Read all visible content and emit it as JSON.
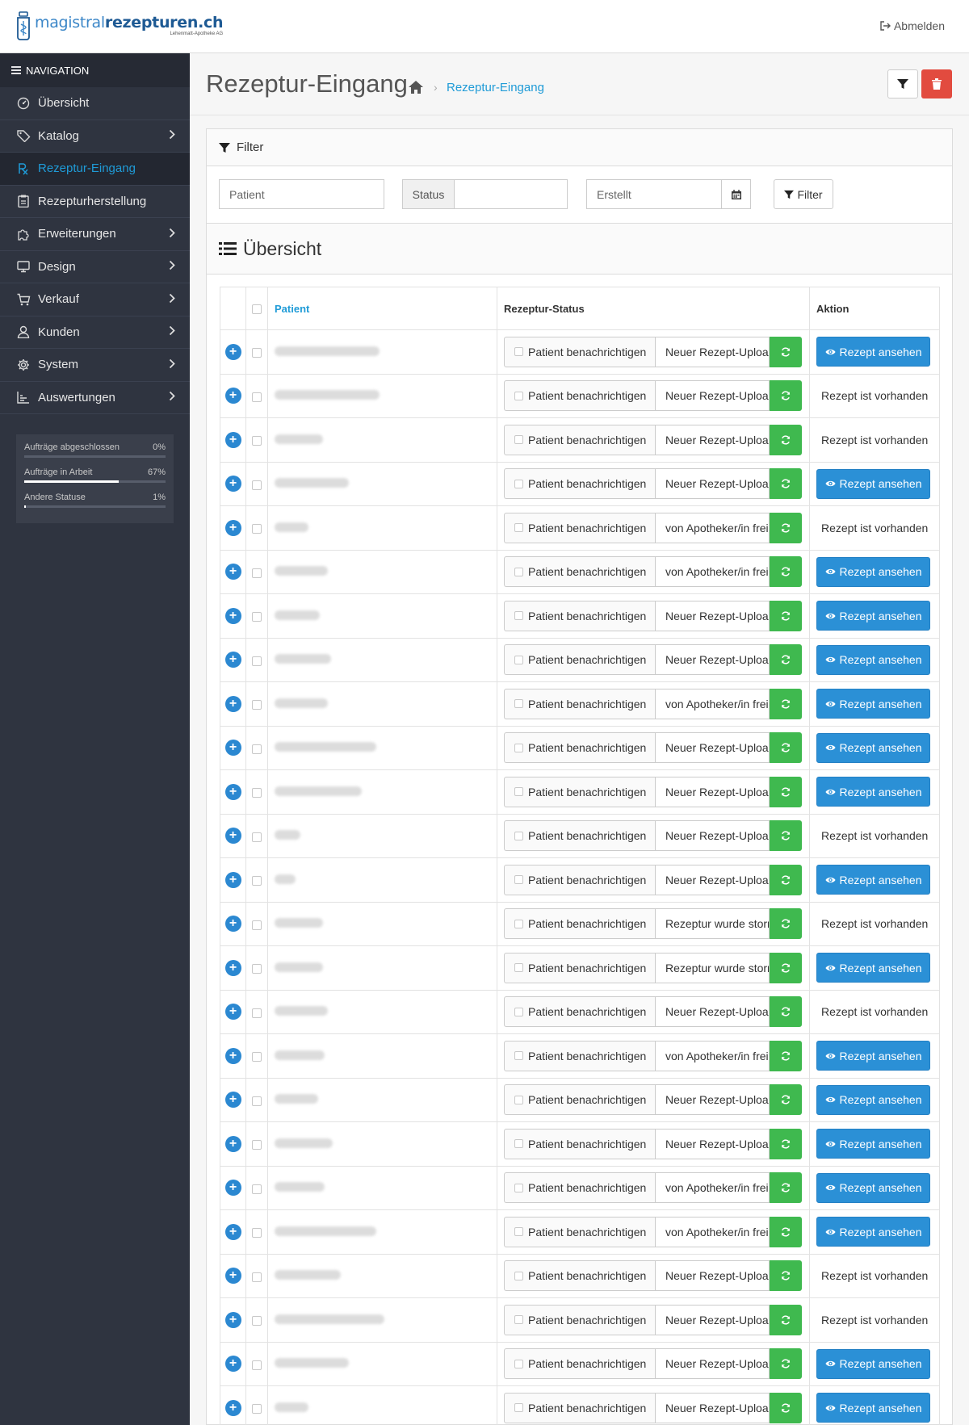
{
  "header": {
    "brand_main": "magistral",
    "brand_bold": "rezepturen.ch",
    "brand_sub": "Lehenmatt-Apotheke AG",
    "logout_label": "Abmelden"
  },
  "sidebar": {
    "heading": "NAVIGATION",
    "items": [
      {
        "label": "Übersicht",
        "icon": "dashboard-icon",
        "chevron": false,
        "active": false
      },
      {
        "label": "Katalog",
        "icon": "tag-icon",
        "chevron": true,
        "active": false
      },
      {
        "label": "Rezeptur-Eingang",
        "icon": "rx-icon",
        "chevron": false,
        "active": true
      },
      {
        "label": "Rezepturherstellung",
        "icon": "clipboard-icon",
        "chevron": false,
        "active": false
      },
      {
        "label": "Erweiterungen",
        "icon": "puzzle-icon",
        "chevron": true,
        "active": false
      },
      {
        "label": "Design",
        "icon": "monitor-icon",
        "chevron": true,
        "active": false
      },
      {
        "label": "Verkauf",
        "icon": "cart-icon",
        "chevron": true,
        "active": false
      },
      {
        "label": "Kunden",
        "icon": "user-icon",
        "chevron": true,
        "active": false
      },
      {
        "label": "System",
        "icon": "gear-icon",
        "chevron": true,
        "active": false
      },
      {
        "label": "Auswertungen",
        "icon": "chart-icon",
        "chevron": true,
        "active": false
      }
    ],
    "stats": [
      {
        "label": "Aufträge abgeschlossen",
        "value": "0%",
        "fraction": 0.0
      },
      {
        "label": "Aufträge in Arbeit",
        "value": "67%",
        "fraction": 0.67
      },
      {
        "label": "Andere Statuse",
        "value": "1%",
        "fraction": 0.01
      }
    ]
  },
  "page": {
    "title": "Rezeptur-Eingang",
    "breadcrumb": "Rezeptur-Eingang"
  },
  "filter": {
    "heading": "Filter",
    "patient_placeholder": "Patient",
    "status_label": "Status",
    "created_placeholder": "Erstellt",
    "button_label": "Filter"
  },
  "list": {
    "heading": "Übersicht",
    "columns": {
      "patient": "Patient",
      "status": "Rezeptur-Status",
      "action": "Aktion"
    },
    "notify_label": "Patient benachrichtigen",
    "view_label": "Rezept ansehen",
    "has_rx_label": "Rezept ist vorhanden",
    "rows": [
      {
        "status": "Neuer Rezept-Upload",
        "action": "view"
      },
      {
        "status": "Neuer Rezept-Upload",
        "action": "has"
      },
      {
        "status": "Neuer Rezept-Upload",
        "action": "has"
      },
      {
        "status": "Neuer Rezept-Upload",
        "action": "view"
      },
      {
        "status": "von Apotheker/in freigegeben",
        "action": "has"
      },
      {
        "status": "von Apotheker/in freigegeben",
        "action": "view"
      },
      {
        "status": "Neuer Rezept-Upload",
        "action": "view"
      },
      {
        "status": "Neuer Rezept-Upload",
        "action": "view"
      },
      {
        "status": "von Apotheker/in freigegeben",
        "action": "view"
      },
      {
        "status": "Neuer Rezept-Upload",
        "action": "view"
      },
      {
        "status": "Neuer Rezept-Upload",
        "action": "view"
      },
      {
        "status": "Neuer Rezept-Upload",
        "action": "has"
      },
      {
        "status": "Neuer Rezept-Upload",
        "action": "view"
      },
      {
        "status": "Rezeptur wurde storniert",
        "action": "has"
      },
      {
        "status": "Rezeptur wurde storniert",
        "action": "view"
      },
      {
        "status": "Neuer Rezept-Upload",
        "action": "has"
      },
      {
        "status": "von Apotheker/in freigegeben",
        "action": "view"
      },
      {
        "status": "Neuer Rezept-Upload",
        "action": "view"
      },
      {
        "status": "Neuer Rezept-Upload",
        "action": "view"
      },
      {
        "status": "von Apotheker/in freigegeben",
        "action": "view"
      },
      {
        "status": "von Apotheker/in freigegeben",
        "action": "view"
      },
      {
        "status": "Neuer Rezept-Upload",
        "action": "has"
      },
      {
        "status": "Neuer Rezept-Upload",
        "action": "has"
      },
      {
        "status": "Neuer Rezept-Upload",
        "action": "view"
      },
      {
        "status": "Neuer Rezept-Upload",
        "action": "view"
      }
    ]
  },
  "colors": {
    "sidebar_bg": "#2f3440",
    "accent_blue": "#1f9bd7",
    "button_blue": "#2b90d6",
    "refresh_green": "#3fb94f",
    "delete_red": "#e24b3f"
  }
}
